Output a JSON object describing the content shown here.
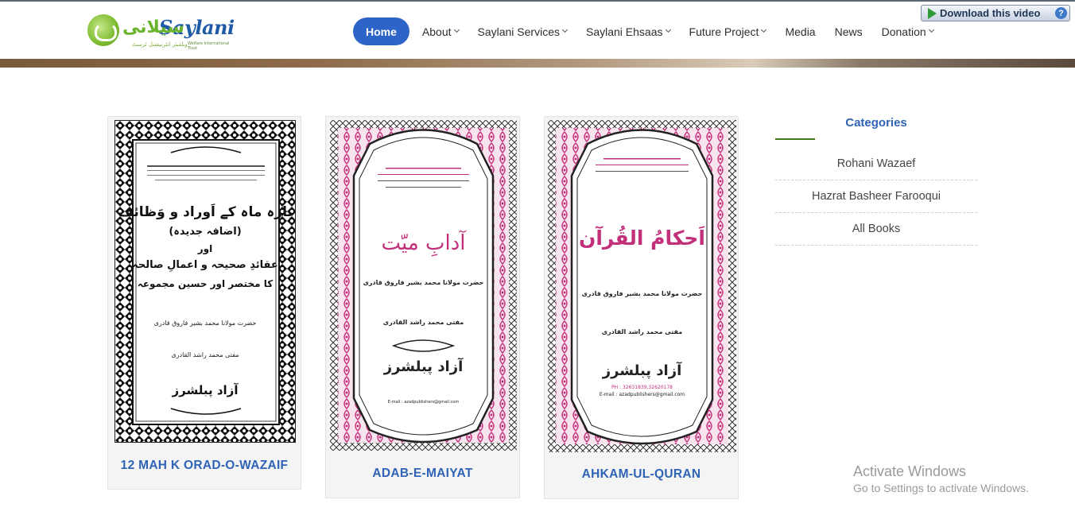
{
  "brand": {
    "logo_text": "Saylani",
    "logo_urdu": "سیلانی",
    "logo_tagline": "Welfare International Trust",
    "logo_urdu_small": "ویلفیئر انٹرنیشنل ٹرسٹ"
  },
  "nav": {
    "items": [
      {
        "label": "Home",
        "active": true,
        "dropdown": false
      },
      {
        "label": "About",
        "active": false,
        "dropdown": true
      },
      {
        "label": "Saylani Services",
        "active": false,
        "dropdown": true
      },
      {
        "label": "Saylani Ehsaas",
        "active": false,
        "dropdown": true
      },
      {
        "label": "Future Project",
        "active": false,
        "dropdown": true
      },
      {
        "label": "Media",
        "active": false,
        "dropdown": false
      },
      {
        "label": "News",
        "active": false,
        "dropdown": false
      },
      {
        "label": "Donation",
        "active": false,
        "dropdown": true
      }
    ]
  },
  "download_button": {
    "label": "Download this video",
    "help": "?"
  },
  "books": [
    {
      "title": "12 MAH K ORAD-O-WAZAIF",
      "cover_style": "bw",
      "cover_heading": "بارہ ماہ کے اَوراد و وَظائف",
      "cover_sub": "(اضافہ جدیدہ)",
      "cover_line3": "اور",
      "cover_line4": "عقائدِ صحیحہ و اعمالِ صالحہ",
      "cover_line5": "کا مختصر اور حسین مجموعہ",
      "author": "حضرت مولانا محمد بشیر فاروق قادری",
      "compiler": "مفتی محمد راشد القادری",
      "publisher": "آزاد پبلشرز"
    },
    {
      "title": "ADAB-E-MAIYAT",
      "cover_style": "pink",
      "cover_heading": "آدابِ میّت",
      "author": "حضرت مولانا محمد بشیر فاروق قادری",
      "compiler": "مفتی محمد راشد القادری",
      "publisher": "آزاد پبلشرز",
      "email": "E-mail : azadpublishers@gmail.com"
    },
    {
      "title": "AHKAM-UL-QURAN",
      "cover_style": "pink",
      "cover_heading": "اَحکامُ القُرآن",
      "author": "حضرت مولانا محمد بشیر فاروق قادری",
      "compiler": "مفتی محمد راشد القادری",
      "publisher": "آزاد پبلشرز",
      "phone": "PH : 32631839,32620178",
      "email": "E-mail : azadpublishers@gmail.com"
    }
  ],
  "sidebar": {
    "title": "Categories",
    "items": [
      "Rohani Wazaef",
      "Hazrat Basheer Farooqui",
      "All Books"
    ]
  },
  "watermark": {
    "line1": "Activate Windows",
    "line2": "Go to Settings to activate Windows."
  },
  "colors": {
    "accent_blue": "#2f63b6",
    "nav_active": "#2d64c8",
    "cover_pink": "#c2307a",
    "underline_green": "#3e7a1a"
  }
}
